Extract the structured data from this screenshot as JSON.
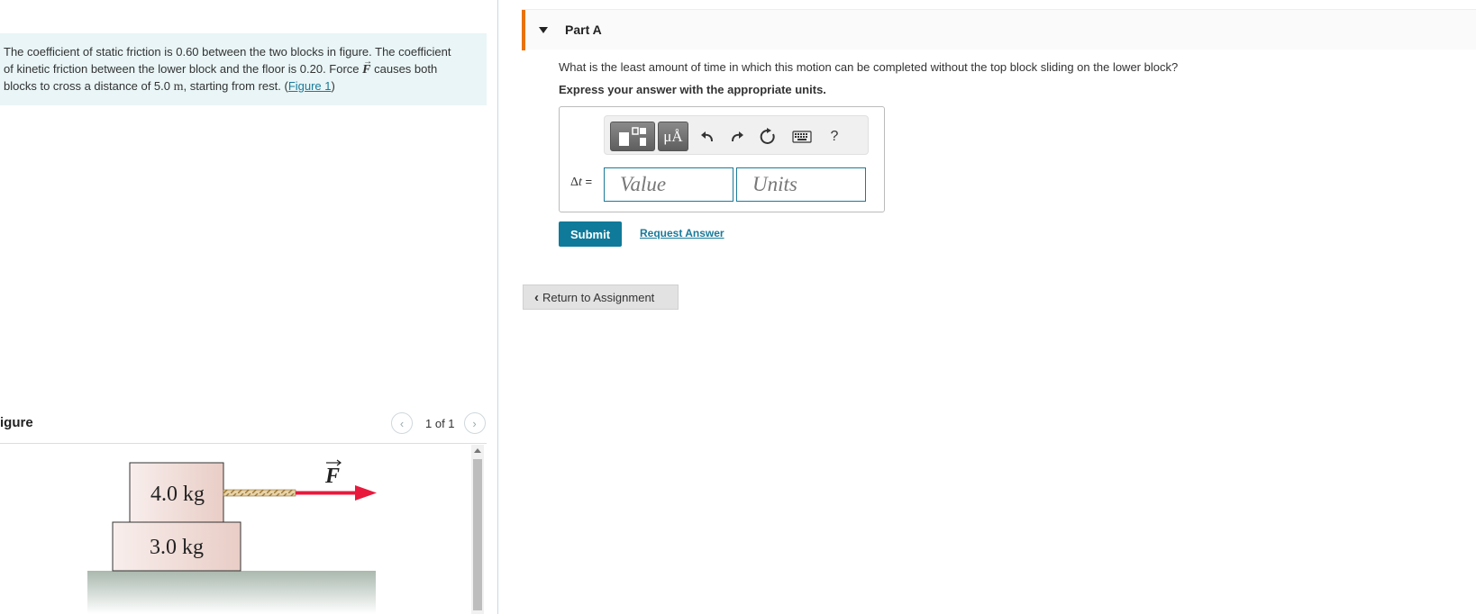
{
  "problem": {
    "text_1": "The coefficient of static friction is 0.60 between the two blocks in figure. The coefficient of kinetic friction between the lower block and the floor is 0.20. Force ",
    "force_symbol": "F",
    "text_2": " causes both blocks to cross a distance of 5.0 ",
    "unit_m": "m",
    "text_3": ", starting from rest. (",
    "figure_link": "Figure 1",
    "text_4": ")"
  },
  "figure": {
    "title": "igure",
    "pager_text": "1 of 1",
    "top_block_label": "4.0 kg",
    "bottom_block_label": "3.0 kg",
    "force_label": "F"
  },
  "part": {
    "title": "Part A",
    "question": "What is the least amount of time in which this motion can be completed without the top block sliding on the lower block?",
    "instruction": "Express your answer with the appropriate units."
  },
  "answer": {
    "label_delta": "Δ",
    "label_var": "t",
    "label_eq": " =",
    "value_placeholder": "Value",
    "units_placeholder": "Units",
    "toolbar_mu_label": "μÅ",
    "toolbar_help_label": "?"
  },
  "actions": {
    "submit_label": "Submit",
    "request_label": "Request Answer",
    "return_label": "Return to Assignment"
  },
  "colors": {
    "accent": "#e8720c",
    "submit": "#0f7a9a",
    "problem_bg": "#e9f5f6",
    "force_arrow": "#e8193c"
  }
}
